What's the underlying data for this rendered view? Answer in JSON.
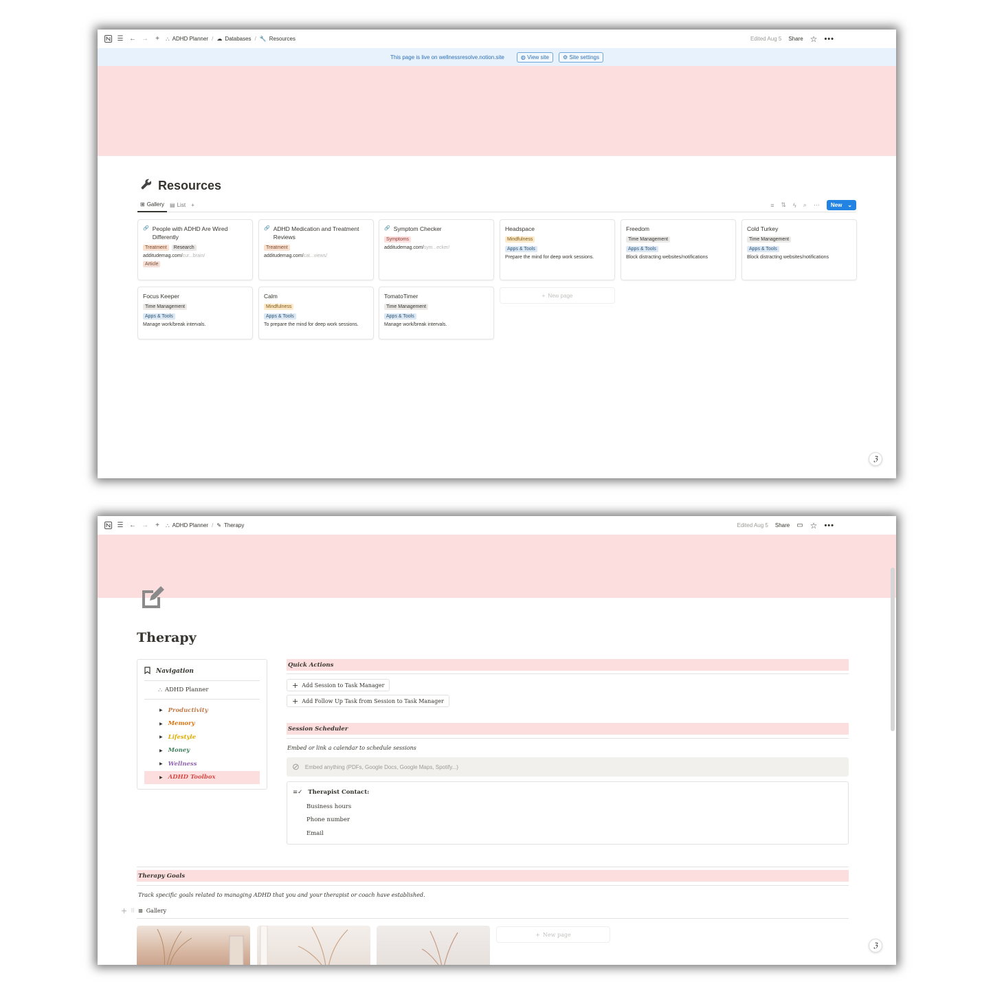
{
  "win1": {
    "breadcrumbs": [
      "ADHD Planner",
      "Databases",
      "Resources"
    ],
    "edited": "Edited Aug 5",
    "share": "Share",
    "live": {
      "text": "This page is live on wellnessresolve.notion.site",
      "view_site": "View site",
      "site_settings": "Site settings"
    },
    "title": "Resources",
    "views": [
      "Gallery",
      "List"
    ],
    "new_label": "New",
    "cards": [
      {
        "title": "People with ADHD Are Wired Differently",
        "tags": [
          "Treatment",
          "Research"
        ],
        "url_a": "additudemag.com/",
        "url_b": "cur...brain/",
        "extra": "Article",
        "desc": ""
      },
      {
        "title": "ADHD Medication and Treatment Reviews",
        "tags": [
          "Treatment"
        ],
        "url_a": "additudemag.com/",
        "url_b": "cat...views/",
        "extra": "",
        "desc": ""
      },
      {
        "title": "Symptom Checker",
        "tags": [
          "Symptoms"
        ],
        "url_a": "additudemag.com/",
        "url_b": "sym...ecker/",
        "extra": "",
        "desc": ""
      },
      {
        "title": "Headspace",
        "tags": [
          "Mindfulness",
          "Apps & Tools"
        ],
        "url_a": "",
        "url_b": "",
        "extra": "",
        "desc": "Prepare the mind for deep work sessions."
      },
      {
        "title": "Freedom",
        "tags": [
          "Time Management",
          "Apps & Tools"
        ],
        "url_a": "",
        "url_b": "",
        "extra": "",
        "desc": "Block distracting websites/notifications"
      },
      {
        "title": "Cold Turkey",
        "tags": [
          "Time Management",
          "Apps & Tools"
        ],
        "url_a": "",
        "url_b": "",
        "extra": "",
        "desc": "Block distracting websites/notifications"
      },
      {
        "title": "Focus Keeper",
        "tags": [
          "Time Management",
          "Apps & Tools"
        ],
        "url_a": "",
        "url_b": "",
        "extra": "",
        "desc": "Manage work/break intervals."
      },
      {
        "title": "Calm",
        "tags": [
          "Mindfulness",
          "Apps & Tools"
        ],
        "url_a": "",
        "url_b": "",
        "extra": "",
        "desc": "To prepare the mind for deep work sessions."
      },
      {
        "title": "TomatoTimer",
        "tags": [
          "Time Management",
          "Apps & Tools"
        ],
        "url_a": "",
        "url_b": "",
        "extra": "",
        "desc": "Manage work/break intervals."
      }
    ],
    "new_page": "New page"
  },
  "win2": {
    "breadcrumbs": [
      "ADHD Planner",
      "Therapy"
    ],
    "edited": "Edited Aug 5",
    "share": "Share",
    "title": "Therapy",
    "nav": {
      "heading": "Navigation",
      "planner": "ADHD Planner",
      "items": [
        {
          "label": "Productivity",
          "color": "#c27c4a"
        },
        {
          "label": "Memory",
          "color": "#d9730d"
        },
        {
          "label": "Lifestyle",
          "color": "#dfab01"
        },
        {
          "label": "Money",
          "color": "#448361"
        },
        {
          "label": "Wellness",
          "color": "#9065b0"
        },
        {
          "label": "ADHD Toolbox",
          "color": "#d44c47"
        }
      ]
    },
    "quick_actions": {
      "heading": "Quick Actions",
      "btn1": "Add Session to Task Manager",
      "btn2": "Add Follow Up Task from Session to Task Manager"
    },
    "scheduler": {
      "heading": "Session Scheduler",
      "subtitle": "Embed or link a calendar to schedule sessions",
      "embed": "Embed anything (PDFs, Google Docs, Google Maps, Spotify...)"
    },
    "contact": {
      "title": "Therapist Contact:",
      "lines": [
        "Business hours",
        "Phone number",
        "Email"
      ]
    },
    "goals": {
      "heading": "Therapy Goals",
      "subtitle": "Track specific goals related to managing ADHD that you and your therapist or coach have established.",
      "view": "Gallery"
    },
    "new_page": "New page"
  }
}
